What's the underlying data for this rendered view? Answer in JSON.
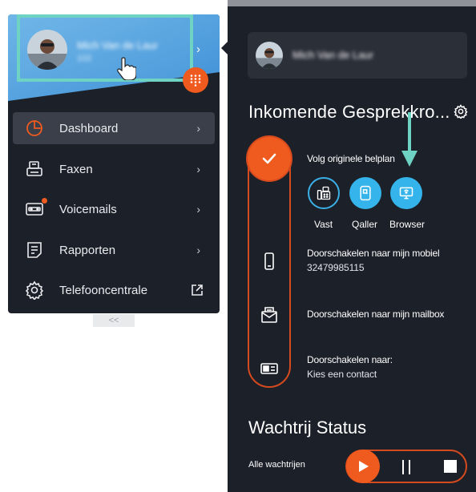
{
  "user": {
    "name": "Mich Van de Laur",
    "extension": "102"
  },
  "menu": {
    "items": [
      {
        "label": "Dashboard",
        "icon": "dashboard-icon",
        "active": true
      },
      {
        "label": "Faxen",
        "icon": "fax-icon"
      },
      {
        "label": "Voicemails",
        "icon": "voicemail-icon",
        "badge": true
      },
      {
        "label": "Rapporten",
        "icon": "report-icon"
      },
      {
        "label": "Telefooncentrale",
        "icon": "settings-icon",
        "external": true
      }
    ],
    "collapse_label": "<<"
  },
  "incoming": {
    "title": "Inkomende Gesprekkro...",
    "follow_plan_label": "Volg originele belplan",
    "devices": [
      {
        "label": "Vast",
        "icon": "desk-phone-icon"
      },
      {
        "label": "Qaller",
        "icon": "qaller-icon"
      },
      {
        "label": "Browser",
        "icon": "browser-phone-icon"
      }
    ],
    "forward_mobile_label": "Doorschakelen naar mijn mobiel",
    "mobile_number": "32479985115",
    "forward_mailbox_label": "Doorschakelen naar mijn mailbox",
    "forward_to_label": "Doorschakelen naar:",
    "choose_contact_label": "Kies een contact"
  },
  "queue": {
    "title": "Wachtrij Status",
    "all_queues_label": "Alle wachtrijen"
  },
  "colors": {
    "panel": "#1c2029",
    "accent": "#ef5a1e",
    "device_blue": "#34b4ea",
    "highlight": "#6fd3c4"
  }
}
